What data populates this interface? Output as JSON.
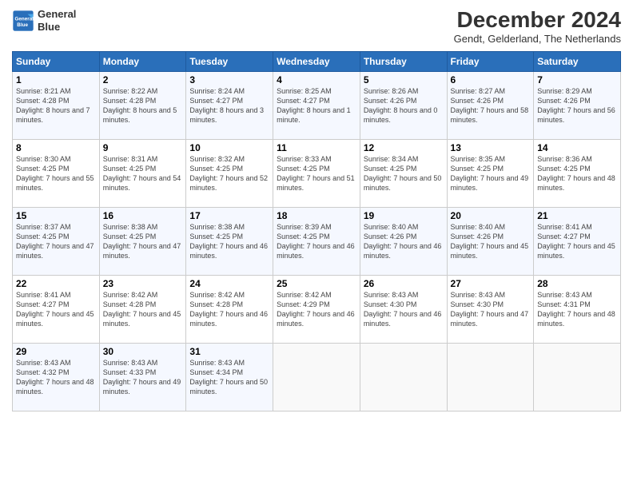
{
  "logo": {
    "line1": "General",
    "line2": "Blue"
  },
  "title": "December 2024",
  "location": "Gendt, Gelderland, The Netherlands",
  "days_header": [
    "Sunday",
    "Monday",
    "Tuesday",
    "Wednesday",
    "Thursday",
    "Friday",
    "Saturday"
  ],
  "weeks": [
    [
      {
        "day": "1",
        "sunrise": "8:21 AM",
        "sunset": "4:28 PM",
        "daylight": "8 hours and 7 minutes."
      },
      {
        "day": "2",
        "sunrise": "8:22 AM",
        "sunset": "4:28 PM",
        "daylight": "8 hours and 5 minutes."
      },
      {
        "day": "3",
        "sunrise": "8:24 AM",
        "sunset": "4:27 PM",
        "daylight": "8 hours and 3 minutes."
      },
      {
        "day": "4",
        "sunrise": "8:25 AM",
        "sunset": "4:27 PM",
        "daylight": "8 hours and 1 minute."
      },
      {
        "day": "5",
        "sunrise": "8:26 AM",
        "sunset": "4:26 PM",
        "daylight": "8 hours and 0 minutes."
      },
      {
        "day": "6",
        "sunrise": "8:27 AM",
        "sunset": "4:26 PM",
        "daylight": "7 hours and 58 minutes."
      },
      {
        "day": "7",
        "sunrise": "8:29 AM",
        "sunset": "4:26 PM",
        "daylight": "7 hours and 56 minutes."
      }
    ],
    [
      {
        "day": "8",
        "sunrise": "8:30 AM",
        "sunset": "4:25 PM",
        "daylight": "7 hours and 55 minutes."
      },
      {
        "day": "9",
        "sunrise": "8:31 AM",
        "sunset": "4:25 PM",
        "daylight": "7 hours and 54 minutes."
      },
      {
        "day": "10",
        "sunrise": "8:32 AM",
        "sunset": "4:25 PM",
        "daylight": "7 hours and 52 minutes."
      },
      {
        "day": "11",
        "sunrise": "8:33 AM",
        "sunset": "4:25 PM",
        "daylight": "7 hours and 51 minutes."
      },
      {
        "day": "12",
        "sunrise": "8:34 AM",
        "sunset": "4:25 PM",
        "daylight": "7 hours and 50 minutes."
      },
      {
        "day": "13",
        "sunrise": "8:35 AM",
        "sunset": "4:25 PM",
        "daylight": "7 hours and 49 minutes."
      },
      {
        "day": "14",
        "sunrise": "8:36 AM",
        "sunset": "4:25 PM",
        "daylight": "7 hours and 48 minutes."
      }
    ],
    [
      {
        "day": "15",
        "sunrise": "8:37 AM",
        "sunset": "4:25 PM",
        "daylight": "7 hours and 47 minutes."
      },
      {
        "day": "16",
        "sunrise": "8:38 AM",
        "sunset": "4:25 PM",
        "daylight": "7 hours and 47 minutes."
      },
      {
        "day": "17",
        "sunrise": "8:38 AM",
        "sunset": "4:25 PM",
        "daylight": "7 hours and 46 minutes."
      },
      {
        "day": "18",
        "sunrise": "8:39 AM",
        "sunset": "4:25 PM",
        "daylight": "7 hours and 46 minutes."
      },
      {
        "day": "19",
        "sunrise": "8:40 AM",
        "sunset": "4:26 PM",
        "daylight": "7 hours and 46 minutes."
      },
      {
        "day": "20",
        "sunrise": "8:40 AM",
        "sunset": "4:26 PM",
        "daylight": "7 hours and 45 minutes."
      },
      {
        "day": "21",
        "sunrise": "8:41 AM",
        "sunset": "4:27 PM",
        "daylight": "7 hours and 45 minutes."
      }
    ],
    [
      {
        "day": "22",
        "sunrise": "8:41 AM",
        "sunset": "4:27 PM",
        "daylight": "7 hours and 45 minutes."
      },
      {
        "day": "23",
        "sunrise": "8:42 AM",
        "sunset": "4:28 PM",
        "daylight": "7 hours and 45 minutes."
      },
      {
        "day": "24",
        "sunrise": "8:42 AM",
        "sunset": "4:28 PM",
        "daylight": "7 hours and 46 minutes."
      },
      {
        "day": "25",
        "sunrise": "8:42 AM",
        "sunset": "4:29 PM",
        "daylight": "7 hours and 46 minutes."
      },
      {
        "day": "26",
        "sunrise": "8:43 AM",
        "sunset": "4:30 PM",
        "daylight": "7 hours and 46 minutes."
      },
      {
        "day": "27",
        "sunrise": "8:43 AM",
        "sunset": "4:30 PM",
        "daylight": "7 hours and 47 minutes."
      },
      {
        "day": "28",
        "sunrise": "8:43 AM",
        "sunset": "4:31 PM",
        "daylight": "7 hours and 48 minutes."
      }
    ],
    [
      {
        "day": "29",
        "sunrise": "8:43 AM",
        "sunset": "4:32 PM",
        "daylight": "7 hours and 48 minutes."
      },
      {
        "day": "30",
        "sunrise": "8:43 AM",
        "sunset": "4:33 PM",
        "daylight": "7 hours and 49 minutes."
      },
      {
        "day": "31",
        "sunrise": "8:43 AM",
        "sunset": "4:34 PM",
        "daylight": "7 hours and 50 minutes."
      },
      null,
      null,
      null,
      null
    ]
  ],
  "labels": {
    "sunrise": "Sunrise:",
    "sunset": "Sunset:",
    "daylight": "Daylight:"
  }
}
